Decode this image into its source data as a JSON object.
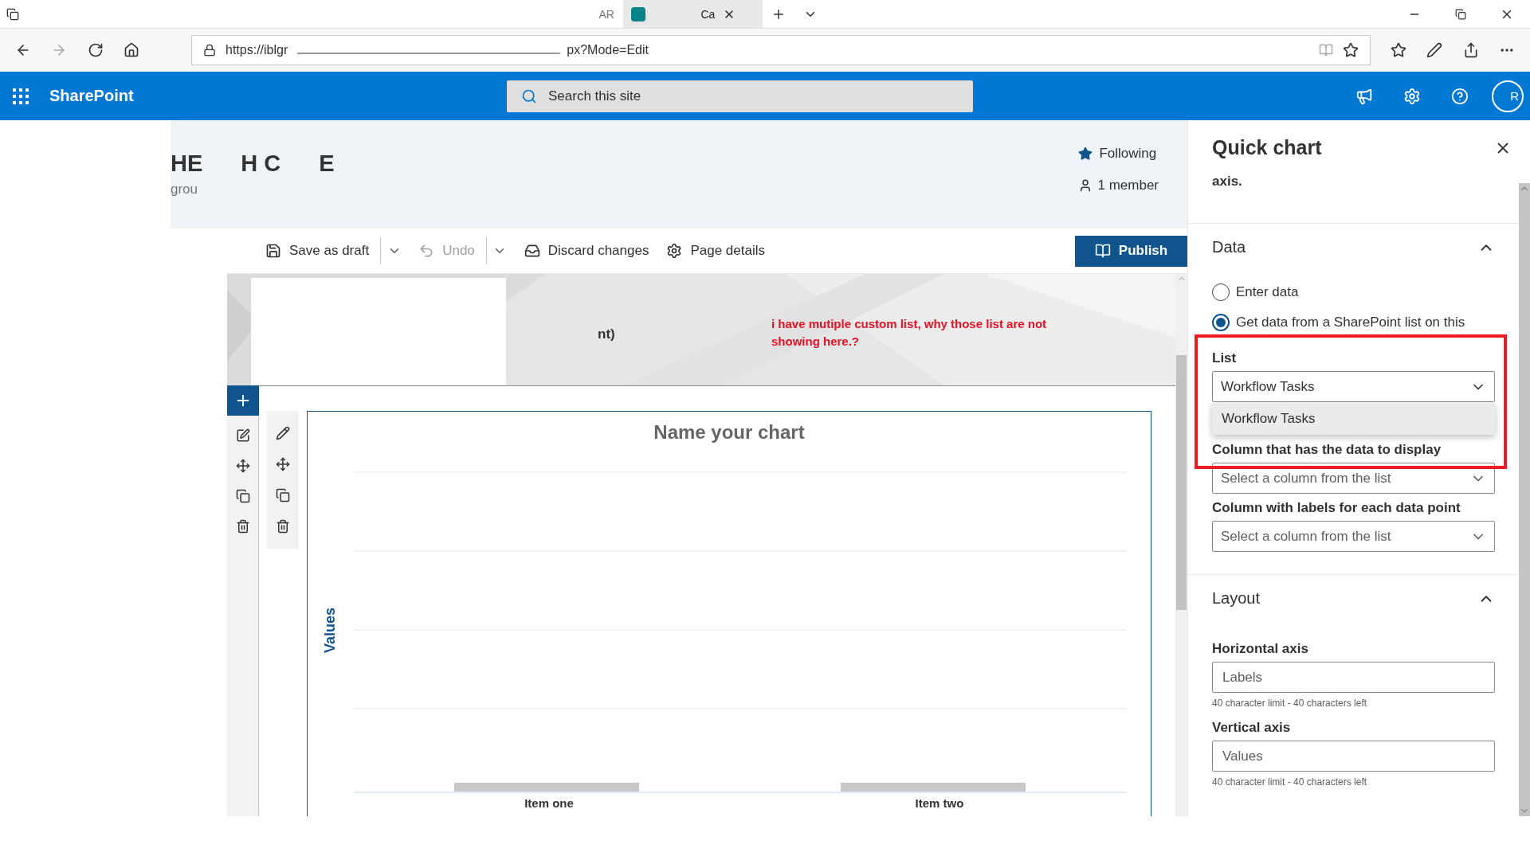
{
  "browser": {
    "tabs": [
      {
        "label": "AR",
        "selected": false
      },
      {
        "label": "Ca",
        "selected": true
      }
    ],
    "address": "https://iblgr",
    "address_tail": "px?Mode=Edit"
  },
  "suite_bar": {
    "app_name": "SharePoint",
    "search_placeholder": "Search this site",
    "avatar": "R"
  },
  "site_header": {
    "title_parts": [
      "HE",
      "H C",
      "E"
    ],
    "subtitle": "grou",
    "following": "Following",
    "members": "1 member"
  },
  "command_bar": {
    "items": [
      {
        "kind": "save",
        "label": "Save as draft",
        "disabled": false,
        "has_menu": true
      },
      {
        "kind": "undo",
        "label": "Undo",
        "disabled": true,
        "has_menu": true
      },
      {
        "kind": "discard",
        "label": "Discard changes",
        "disabled": false,
        "has_menu": false
      },
      {
        "kind": "details",
        "label": "Page details",
        "disabled": false,
        "has_menu": false
      }
    ],
    "publish": "Publish"
  },
  "banner": {
    "text": "nt)"
  },
  "annotation": "i have mutiple custom list, why those list are not showing here.?",
  "chart": {
    "title": "Name your chart",
    "axis_label": "Values",
    "categories": [
      "Item one",
      "Item two"
    ]
  },
  "panel": {
    "title": "Quick chart",
    "intro_tail": "axis.",
    "data_section": {
      "title": "Data",
      "expanded": true,
      "options": [
        {
          "label": "Enter data",
          "selected": false
        },
        {
          "label": "Get data from a SharePoint list on this",
          "selected": true
        }
      ],
      "list": {
        "label": "List",
        "value": "Workflow Tasks",
        "open": true,
        "options": [
          {
            "label": "Workflow Tasks",
            "selected": true
          }
        ]
      },
      "columns": [
        {
          "label": "Column that has the data to display",
          "placeholder": "Select a column from the list"
        },
        {
          "label": "Column with labels for each data point",
          "placeholder": "Select a column from the list"
        }
      ]
    },
    "layout_section": {
      "title": "Layout",
      "expanded": true,
      "fields": [
        {
          "label": "Horizontal axis",
          "placeholder": "Labels",
          "hint": "40 character limit - 40 characters left"
        },
        {
          "label": "Vertical axis",
          "placeholder": "Values",
          "hint": "40 character limit - 40 characters left"
        }
      ]
    }
  }
}
